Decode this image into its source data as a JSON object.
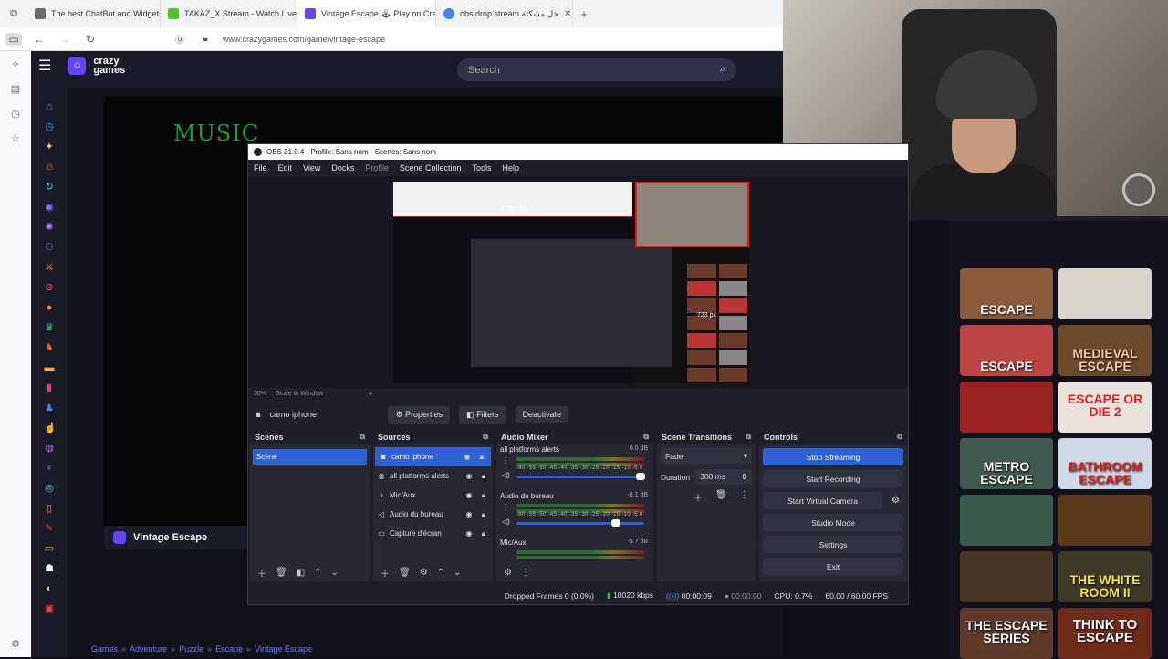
{
  "browser": {
    "tabs": [
      {
        "title": "The best ChatBot and Widgets",
        "color": "#6d6d6d"
      },
      {
        "title": "TAKAZ_X Stream - Watch Live o",
        "color": "#53c22b"
      },
      {
        "title": "Vintage Escape 🕹 Play on Cra",
        "color": "#6842ff"
      },
      {
        "title": "obs drop stream حل مشكلة",
        "color": "#4285f4"
      }
    ],
    "url": "www.crazygames.com/game/vintage-escape"
  },
  "crazygames": {
    "logo_line1": "crazy",
    "logo_line2": "games",
    "search_placeholder": "Search",
    "game_title": "Vintage Escape",
    "game_art_text": "MUSIC",
    "breadcrumb": [
      "Games",
      "Adventure",
      "Puzzle",
      "Escape",
      "Vintage Escape"
    ],
    "thumbs": [
      {
        "label": "ESCAPE",
        "color": "#8a5a3a"
      },
      {
        "label": "",
        "color": "#d9d4cc"
      },
      {
        "label": "ESCAPE",
        "color": "#b44"
      },
      {
        "label": "MEDIEVAL ESCAPE",
        "color": "#6b4a2a"
      },
      {
        "label": "",
        "color": "#9b2222"
      },
      {
        "label": "ESCAPE OR DIE 2",
        "color": "#e9e3dc"
      },
      {
        "label": "METRO ESCAPE",
        "color": "#3f5a4e"
      },
      {
        "label": "BATHROOM ESCAPE",
        "color": "#cfd9e6"
      },
      {
        "label": "",
        "color": "#3a5a4a"
      },
      {
        "label": "",
        "color": "#5a3a1a"
      },
      {
        "label": "",
        "color": "#4a3626"
      },
      {
        "label": "THE WHITE ROOM II",
        "color": "#3d3a2a"
      },
      {
        "label": "THE ESCAPE SERIES",
        "color": "#5e3a2a"
      },
      {
        "label": "THINK TO ESCAPE",
        "color": "#6e2a1a"
      }
    ]
  },
  "obs": {
    "title": "OBS 31.0.4 - Profile: Sans nom - Scenes: Sans nom",
    "menu": [
      "File",
      "Edit",
      "View",
      "Docks",
      "Profile",
      "Scene Collection",
      "Tools",
      "Help"
    ],
    "preview": {
      "width_label": "1287 px",
      "height_label": "723 px"
    },
    "zoom": "30%",
    "scale_mode": "Scale to Window",
    "selected_source": "camo iphone",
    "btn_properties": "Properties",
    "btn_filters": "Filters",
    "btn_deactivate": "Deactivate",
    "docks": {
      "scenes": "Scenes",
      "sources": "Sources",
      "mixer": "Audio Mixer",
      "transitions": "Scene Transitions",
      "controls": "Controls"
    },
    "scenes": [
      "Scène"
    ],
    "sources": [
      {
        "name": "camo iphone",
        "icon": "camera-icon"
      },
      {
        "name": "all platforms alerts",
        "icon": "globe-icon"
      },
      {
        "name": "Mic/Aux",
        "icon": "mic-icon"
      },
      {
        "name": "Audio du bureau",
        "icon": "speaker-icon"
      },
      {
        "name": "Capture d'écran",
        "icon": "monitor-icon"
      }
    ],
    "mixer": [
      {
        "name": "all platforms alerts",
        "db": "0.0 dB",
        "level": 0.97
      },
      {
        "name": "Audio du bureau",
        "db": "-6.1 dB",
        "level": 0.78
      },
      {
        "name": "Mic/Aux",
        "db": "-5.7 dB",
        "level": 0.8
      }
    ],
    "meter_scale": "-60 -55 -50 -45 -40 -35 -30 -25 -20 -15 -10 -5 0",
    "transition": "Fade",
    "duration_label": "Duration",
    "duration": "300 ms",
    "controls": [
      "Stop Streaming",
      "Start Recording",
      "Start Virtual Camera",
      "Studio Mode",
      "Settings",
      "Exit"
    ],
    "status": {
      "dropped": "Dropped Frames 0 (0.0%)",
      "kbps": "10020 kbps",
      "stream_time": "00:00:09",
      "rec_time": "00:00:00",
      "cpu": "CPU: 0.7%",
      "fps": "60.00 / 60.00 FPS"
    }
  }
}
